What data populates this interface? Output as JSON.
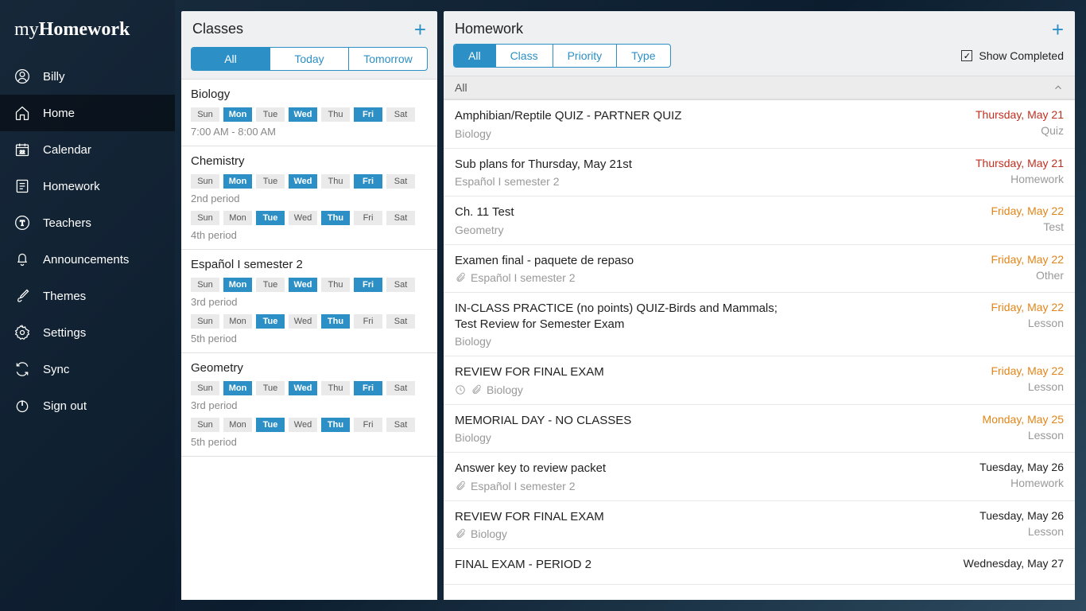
{
  "app": {
    "logo1": "my",
    "logo2": "Homework"
  },
  "user": {
    "name": "Billy"
  },
  "nav": {
    "home": "Home",
    "calendar": "Calendar",
    "homework": "Homework",
    "teachers": "Teachers",
    "announcements": "Announcements",
    "themes": "Themes",
    "settings": "Settings",
    "sync": "Sync",
    "signout": "Sign out"
  },
  "classes_panel": {
    "title": "Classes",
    "tabs": {
      "all": "All",
      "today": "Today",
      "tomorrow": "Tomorrow"
    }
  },
  "days": {
    "sun": "Sun",
    "mon": "Mon",
    "tue": "Tue",
    "wed": "Wed",
    "thu": "Thu",
    "fri": "Fri",
    "sat": "Sat"
  },
  "classes": {
    "biology": {
      "name": "Biology",
      "time": "7:00 AM - 8:00 AM"
    },
    "chemistry": {
      "name": "Chemistry",
      "p1": "2nd period",
      "p2": "4th period"
    },
    "espanol": {
      "name": "Español I semester 2",
      "p1": "3rd period",
      "p2": "5th period"
    },
    "geometry": {
      "name": "Geometry",
      "p1": "3rd period",
      "p2": "5th period"
    }
  },
  "homework_panel": {
    "title": "Homework",
    "tabs": {
      "all": "All",
      "class": "Class",
      "priority": "Priority",
      "type": "Type"
    },
    "show_completed": "Show Completed",
    "filter_label": "All"
  },
  "hw": {
    "0": {
      "title": "Amphibian/Reptile QUIZ - PARTNER QUIZ",
      "sub": "Biology",
      "date": "Thursday, May 21",
      "type": "Quiz",
      "cls": "d-red"
    },
    "1": {
      "title": "Sub plans for Thursday, May 21st",
      "sub": "Español I semester 2",
      "date": "Thursday, May 21",
      "type": "Homework",
      "cls": "d-red"
    },
    "2": {
      "title": "Ch. 11 Test",
      "sub": "Geometry",
      "date": "Friday, May 22",
      "type": "Test",
      "cls": "d-orange"
    },
    "3": {
      "title": "Examen final - paquete de repaso",
      "sub": "Español I semester 2",
      "date": "Friday, May 22",
      "type": "Other",
      "cls": "d-orange"
    },
    "4": {
      "title": "IN-CLASS PRACTICE (no points) QUIZ-Birds and Mammals; Test Review for Semester Exam",
      "sub": "Biology",
      "date": "Friday, May 22",
      "type": "Lesson",
      "cls": "d-orange"
    },
    "5": {
      "title": "REVIEW FOR FINAL EXAM",
      "sub": "Biology",
      "date": "Friday, May 22",
      "type": "Lesson",
      "cls": "d-orange"
    },
    "6": {
      "title": "MEMORIAL DAY - NO CLASSES",
      "sub": "Biology",
      "date": "Monday, May 25",
      "type": "Lesson",
      "cls": "d-orange"
    },
    "7": {
      "title": "Answer key to review packet",
      "sub": "Español I semester 2",
      "date": "Tuesday, May 26",
      "type": "Homework",
      "cls": "d-black"
    },
    "8": {
      "title": "REVIEW FOR FINAL EXAM",
      "sub": "Biology",
      "date": "Tuesday, May 26",
      "type": "Lesson",
      "cls": "d-black"
    },
    "9": {
      "title": "FINAL EXAM - PERIOD 2",
      "sub": "",
      "date": "Wednesday, May 27",
      "type": "",
      "cls": "d-black"
    }
  }
}
